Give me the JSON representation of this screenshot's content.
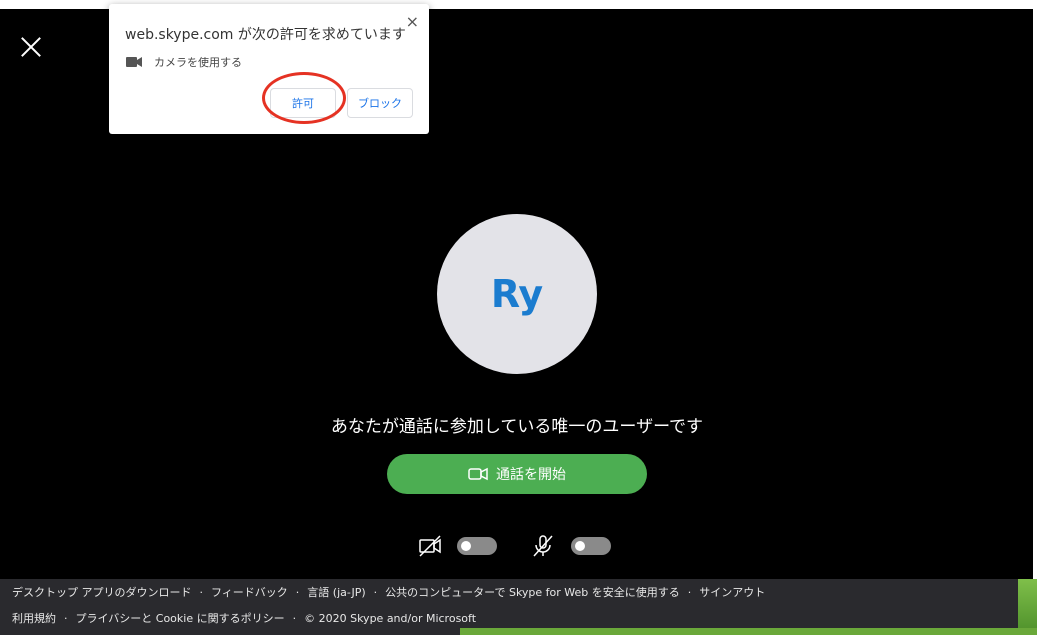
{
  "permission": {
    "title": "web.skype.com が次の許可を求めています",
    "close": "×",
    "request": "カメラを使用する",
    "allow": "許可",
    "block": "ブロック"
  },
  "call": {
    "avatar_initials": "Ry",
    "only_user_text": "あなたが通話に参加している唯一のユーザーです",
    "start_call": "通話を開始",
    "video_toggle_on": false,
    "mic_toggle_on": false
  },
  "footer": {
    "row1": [
      "デスクトップ アプリのダウンロード",
      "フィードバック",
      "言語 (ja-JP)",
      "公共のコンピューターで Skype for Web を安全に使用する",
      "サインアウト"
    ],
    "row2": [
      "利用規約",
      "プライバシーと Cookie に関するポリシー",
      "© 2020 Skype and/or Microsoft"
    ],
    "separator": "·"
  },
  "colors": {
    "start_button": "#4cae52",
    "avatar_text": "#1b7ccf",
    "highlight_ring": "#e53223"
  }
}
